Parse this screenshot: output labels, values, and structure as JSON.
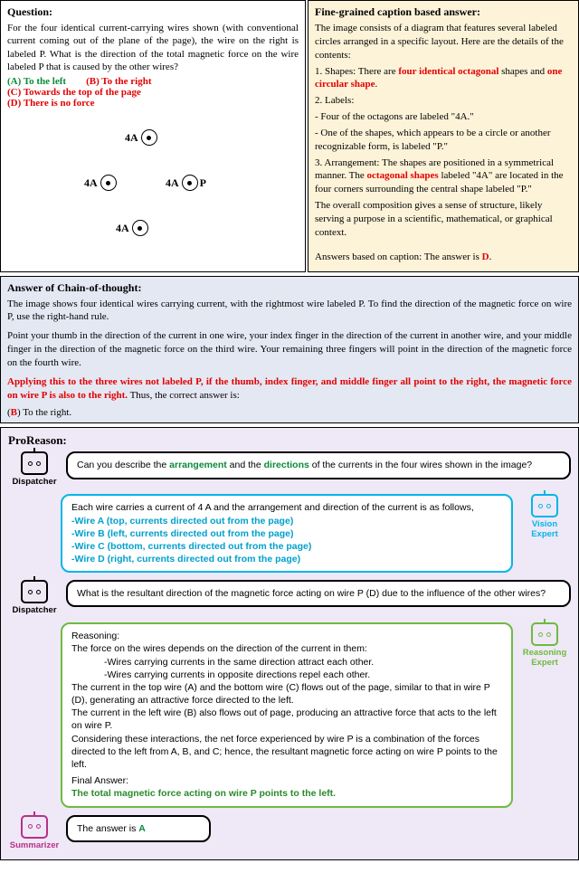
{
  "question": {
    "heading": "Question:",
    "text": "For the four identical current-carrying wires shown (with conventional current coming out of the plane of the page), the wire on the right is labeled P. What is the direction of the total magnetic force on the wire labeled P that is caused by the other wires?",
    "optA": "(A) To the left",
    "optB": "(B) To the right",
    "optC": "(C) Towards the top of the page",
    "optD": "(D) There is no force",
    "wireTop": "4A",
    "wireLeft": "4A",
    "wireBottom": "4A",
    "wireRight": "4A",
    "wireP": "P"
  },
  "caption": {
    "heading": "Fine-grained caption based answer:",
    "l1": "The image consists of a diagram that features several labeled circles arranged in a specific layout. Here are the details of the contents:",
    "l2a": "1. Shapes: There are ",
    "l2b": "four identical octagonal",
    "l2c": " shapes and ",
    "l2d": "one circular shape",
    "l2e": ".",
    "l3": "2. Labels:",
    "l4": "- Four of the octagons are labeled \"4A.\"",
    "l5": "- One of the shapes, which appears to be a circle or another recognizable form, is labeled \"P.\"",
    "l6a": "3. Arrangement: The shapes are positioned in a symmetrical manner. The ",
    "l6b": "octagonal shapes",
    "l6c": " labeled \"4A\" are located in the four corners surrounding the central shape labeled \"P.\"",
    "l7": "The overall composition gives a sense of structure, likely serving a purpose in a scientific, mathematical, or graphical context.",
    "ans_a": "Answers based on caption: The answer is ",
    "ans_b": "D",
    "ans_c": "."
  },
  "cot": {
    "heading": "Answer of Chain-of-thought:",
    "p1": "The image shows four identical wires carrying current, with the rightmost wire labeled P. To find the direction of the magnetic force on wire P, use the right-hand rule.",
    "p2": "Point your thumb in the direction of the current in one wire, your index finger in the direction of the current in another wire, and your middle finger in the direction of the magnetic force on the third wire. Your remaining three fingers will point in the direction of the magnetic force on the fourth wire.",
    "p3a": "Applying this to the three wires not labeled P, if the thumb, index finger, and middle finger all point to the right, the magnetic force on wire P is also to the right.",
    "p3b": " Thus, the correct answer is:",
    "ans_a": "(",
    "ans_b": "B",
    "ans_c": ") To the right."
  },
  "pr": {
    "title": "ProReason:",
    "dispatcher_label": "Dispatcher",
    "vision_label": "Vision Expert",
    "reasoning_label": "Reasoning Expert",
    "summarizer_label": "Summarizer",
    "d1a": "Can you describe the ",
    "d1b": "arrangement",
    "d1c": " and the ",
    "d1d": "directions",
    "d1e": " of the currents in the four wires shown in the image?",
    "v_intro": "Each wire carries a current of 4 A and the arrangement and direction of the current is as follows,",
    "vA": "-Wire A (top, currents directed out from the page)",
    "vB": "-Wire B (left, currents directed out from the page)",
    "vC": "-Wire C (bottom, currents directed out from the page)",
    "vD": "-Wire D (right, currents directed out from the page)",
    "d2": "What is the resultant direction of the magnetic force acting on wire P (D) due to the influence of the other wires?",
    "r_h": "Reasoning:",
    "r1": "The force on the wires depends on the direction of the current in them:",
    "r1a": "-Wires carrying currents in the same direction attract each other.",
    "r1b": "-Wires carrying currents in opposite directions repel each other.",
    "r2": "The current in the top wire (A) and the bottom wire (C) flows out of the page, similar to that in wire P (D), generating an attractive force directed to the left.",
    "r3": "The current in the left wire (B) also flows out of page, producing an attractive force that acts to the left on wire P.",
    "r4": "Considering these interactions, the net force experienced by wire P is a combination of the forces directed to the left from A, B, and C; hence, the resultant magnetic force acting on wire P points to the left.",
    "r_fa": "Final Answer:",
    "r_fb": "The total magnetic force acting on wire P points to the left.",
    "s_a": "The answer is ",
    "s_b": "A"
  }
}
